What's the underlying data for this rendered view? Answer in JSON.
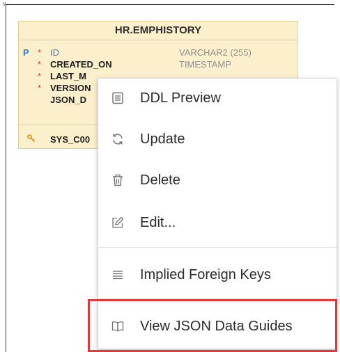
{
  "entity": {
    "schema": "HR.",
    "name": "EMPHISTORY",
    "columns": [
      {
        "pk": "P",
        "required": "*",
        "name": "ID",
        "type": "VARCHAR2 (255)"
      },
      {
        "pk": "",
        "required": "*",
        "name": "CREATED_ON",
        "type": "TIMESTAMP"
      },
      {
        "pk": "",
        "required": "*",
        "name": "LAST_M",
        "type": ""
      },
      {
        "pk": "",
        "required": "*",
        "name": "VERSION",
        "type": ""
      },
      {
        "pk": "",
        "required": "",
        "name": "JSON_D",
        "type": ""
      }
    ],
    "index": {
      "name": "SYS_C00"
    }
  },
  "context_menu": {
    "items": [
      {
        "label": "DDL Preview",
        "icon": "ddl-preview-icon"
      },
      {
        "label": "Update",
        "icon": "refresh-icon"
      },
      {
        "label": "Delete",
        "icon": "trash-icon"
      },
      {
        "label": "Edit...",
        "icon": "edit-icon"
      },
      {
        "label": "Implied Foreign Keys",
        "icon": "lines-icon"
      },
      {
        "label": "View JSON Data Guides",
        "icon": "book-icon"
      }
    ]
  },
  "colors": {
    "entity_bg": "#fcefcc",
    "pk_blue": "#2a80d6",
    "required_red": "#e0393c",
    "type_gray": "#909090",
    "highlight_red": "#e0393c"
  }
}
